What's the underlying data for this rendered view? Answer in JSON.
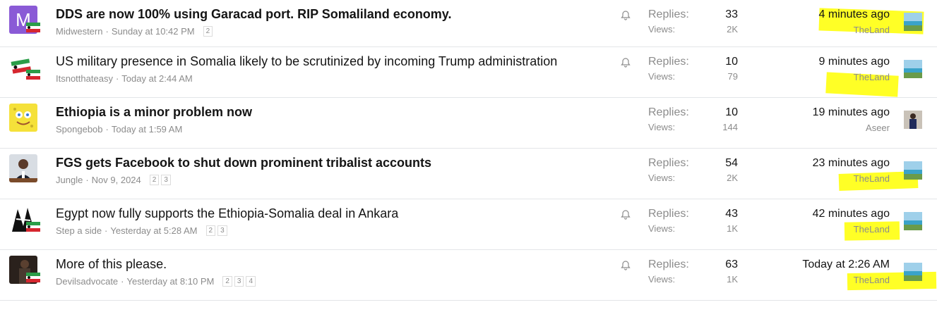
{
  "threads": [
    {
      "title": "DDS are now 100% using Garacad port. RIP Somaliland economy.",
      "bold": true,
      "author": "Midwestern",
      "date": "Sunday at 10:42 PM",
      "pages": [
        "2"
      ],
      "watched": true,
      "replies_label": "Replies:",
      "replies": "33",
      "views_label": "Views:",
      "views": "2K",
      "last_time": "4 minutes ago",
      "last_user": "TheLand",
      "avatar": "letter-m",
      "avatar_letter": "M"
    },
    {
      "title": "US military presence in Somalia likely to be scrutinized by incoming Trump administration",
      "bold": false,
      "author": "Itsnotthateasy",
      "date": "Today at 2:44 AM",
      "pages": [],
      "watched": true,
      "replies_label": "Replies:",
      "replies": "10",
      "views_label": "Views:",
      "views": "79",
      "last_time": "9 minutes ago",
      "last_user": "TheLand",
      "avatar": "flags"
    },
    {
      "title": "Ethiopia is a minor problem now",
      "bold": true,
      "author": "Spongebob",
      "date": "Today at 1:59 AM",
      "pages": [],
      "watched": false,
      "replies_label": "Replies:",
      "replies": "10",
      "views_label": "Views:",
      "views": "144",
      "last_time": "19 minutes ago",
      "last_user": "Aseer",
      "avatar": "sponge"
    },
    {
      "title": "FGS gets Facebook to shut down prominent tribalist accounts",
      "bold": true,
      "author": "Jungle",
      "date": "Nov 9, 2024",
      "pages": [
        "2",
        "3"
      ],
      "watched": false,
      "replies_label": "Replies:",
      "replies": "54",
      "views_label": "Views:",
      "views": "2K",
      "last_time": "23 minutes ago",
      "last_user": "TheLand",
      "avatar": "person"
    },
    {
      "title": "Egypt now fully supports the Ethiopia-Somalia deal in Ankara",
      "bold": false,
      "author": "Step a side",
      "date": "Yesterday at 5:28 AM",
      "pages": [
        "2",
        "3"
      ],
      "watched": true,
      "replies_label": "Replies:",
      "replies": "43",
      "views_label": "Views:",
      "views": "1K",
      "last_time": "42 minutes ago",
      "last_user": "TheLand",
      "avatar": "bw"
    },
    {
      "title": "More of this please.",
      "bold": false,
      "author": "Devilsadvocate",
      "date": "Yesterday at 8:10 PM",
      "pages": [
        "2",
        "3",
        "4"
      ],
      "watched": true,
      "replies_label": "Replies:",
      "replies": "63",
      "views_label": "Views:",
      "views": "1K",
      "last_time": "Today at 2:26 AM",
      "last_user": "TheLand",
      "avatar": "dark"
    }
  ],
  "colors": {
    "highlight": "#ffff00",
    "avatar_purple": "#8a5ad6",
    "muted": "#8c8c8c"
  }
}
